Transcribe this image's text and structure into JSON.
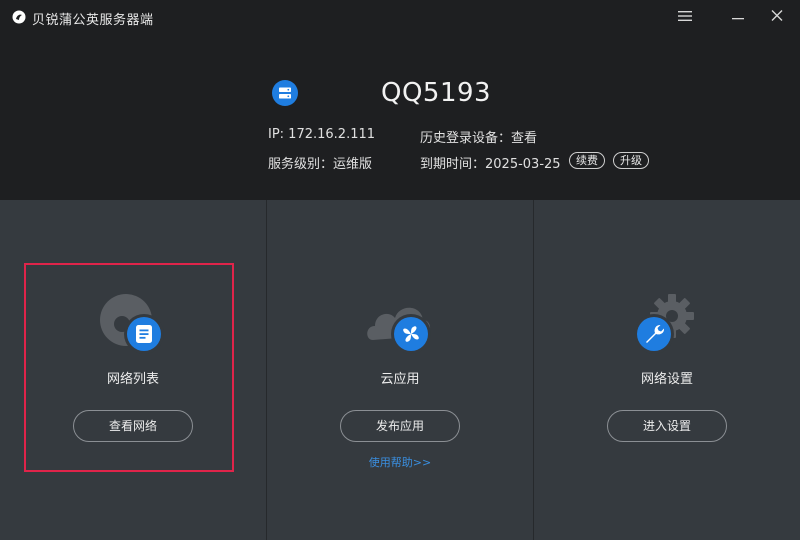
{
  "window": {
    "title": "贝锐蒲公英服务器端"
  },
  "account": {
    "name": "QQ5193",
    "ip": "IP: 172.16.2.111",
    "level": "服务级别：运维版",
    "history": "历史登录设备：查看",
    "expiry": "到期时间：2025-03-25",
    "renew_label": "续费",
    "upgrade_label": "升级"
  },
  "panels": [
    {
      "title": "网络列表",
      "button": "查看网络",
      "icon": "network-list-icon"
    },
    {
      "title": "云应用",
      "button": "发布应用",
      "icon": "cloud-app-icon",
      "help": "使用帮助>>"
    },
    {
      "title": "网络设置",
      "button": "进入设置",
      "icon": "network-settings-icon"
    }
  ],
  "colors": {
    "accent": "#1f7de0",
    "header_bg": "#1e1f21",
    "panel_bg": "#353a3f",
    "highlight": "#e0244a",
    "link": "#3a8fe0"
  }
}
